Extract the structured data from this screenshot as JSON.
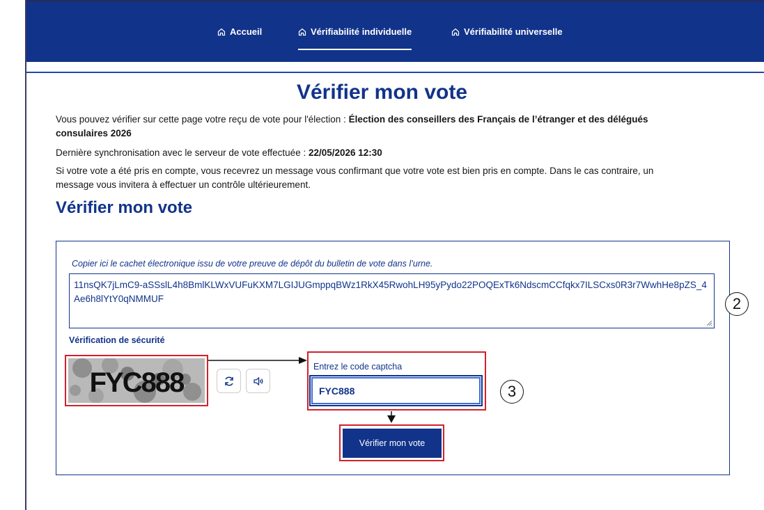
{
  "nav": {
    "items": [
      {
        "label": "Accueil",
        "icon": "home-icon"
      },
      {
        "label": "Vérifiabilité individuelle",
        "icon": "home-icon",
        "active": true
      },
      {
        "label": "Vérifiabilité universelle",
        "icon": "home-icon"
      }
    ]
  },
  "page": {
    "title": "Vérifier mon vote",
    "intro_text": "Vous pouvez vérifier sur cette page votre reçu de vote pour l'élection : ",
    "election_name": "Élection des conseillers des Français de l’étranger et des délégués consulaires 2026",
    "sync_text": "Dernière synchronisation avec le serveur de vote effectuée : ",
    "sync_date": "22/05/2026 12:30",
    "info_text": "Si votre vote a été pris en compte, vous recevrez un message vous confirmant que votre vote est bien pris en compte. Dans le cas contraire, un message vous invitera à effectuer un contrôle ultérieurement.",
    "section_title": "Vérifier mon vote"
  },
  "form": {
    "cachet_label": "Copier ici le cachet électronique issu de votre preuve de dépôt du bulletin de vote dans l’urne.",
    "cachet_value": "11nsQK7jLmC9-aSSslL4h8BmlKLWxVUFuKXM7LGIJUGmppqBWz1RkX45RwohLH95yPydo22POQExTk6NdscmCCfqkx7ILSCxs0R3r7WwhHe8pZS_4Ae6h8lYtY0qNMMUF",
    "security_label": "Vérification de sécurité",
    "captcha_label": "Entrez le code captcha",
    "captcha_value": "FYC888",
    "captcha_image_text": "FYC888",
    "refresh_icon": "refresh-icon",
    "audio_icon": "audio-icon",
    "submit_label": "Vérifier mon vote"
  },
  "annotations": {
    "two": "2",
    "three": "3"
  },
  "colors": {
    "primary": "#11338a",
    "highlight": "#d0212b"
  }
}
